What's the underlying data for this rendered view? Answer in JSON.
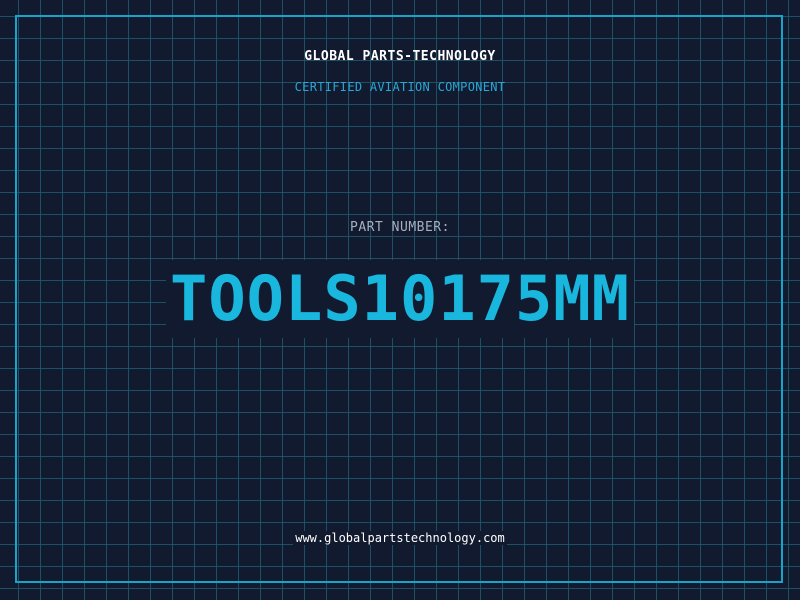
{
  "header": {
    "company": "GLOBAL PARTS-TECHNOLOGY",
    "subtitle": "CERTIFIED AVIATION COMPONENT"
  },
  "part": {
    "label": "PART NUMBER:",
    "number": "TOOLS10175MM"
  },
  "footer": {
    "website": "www.globalpartstechnology.com"
  },
  "colors": {
    "background": "#111a2e",
    "grid": "#1f5a6e",
    "frame": "#19a3c9",
    "accent": "#19b6de",
    "subtitle": "#2aa7d6",
    "label": "#a6b0c0",
    "text": "#ffffff"
  }
}
